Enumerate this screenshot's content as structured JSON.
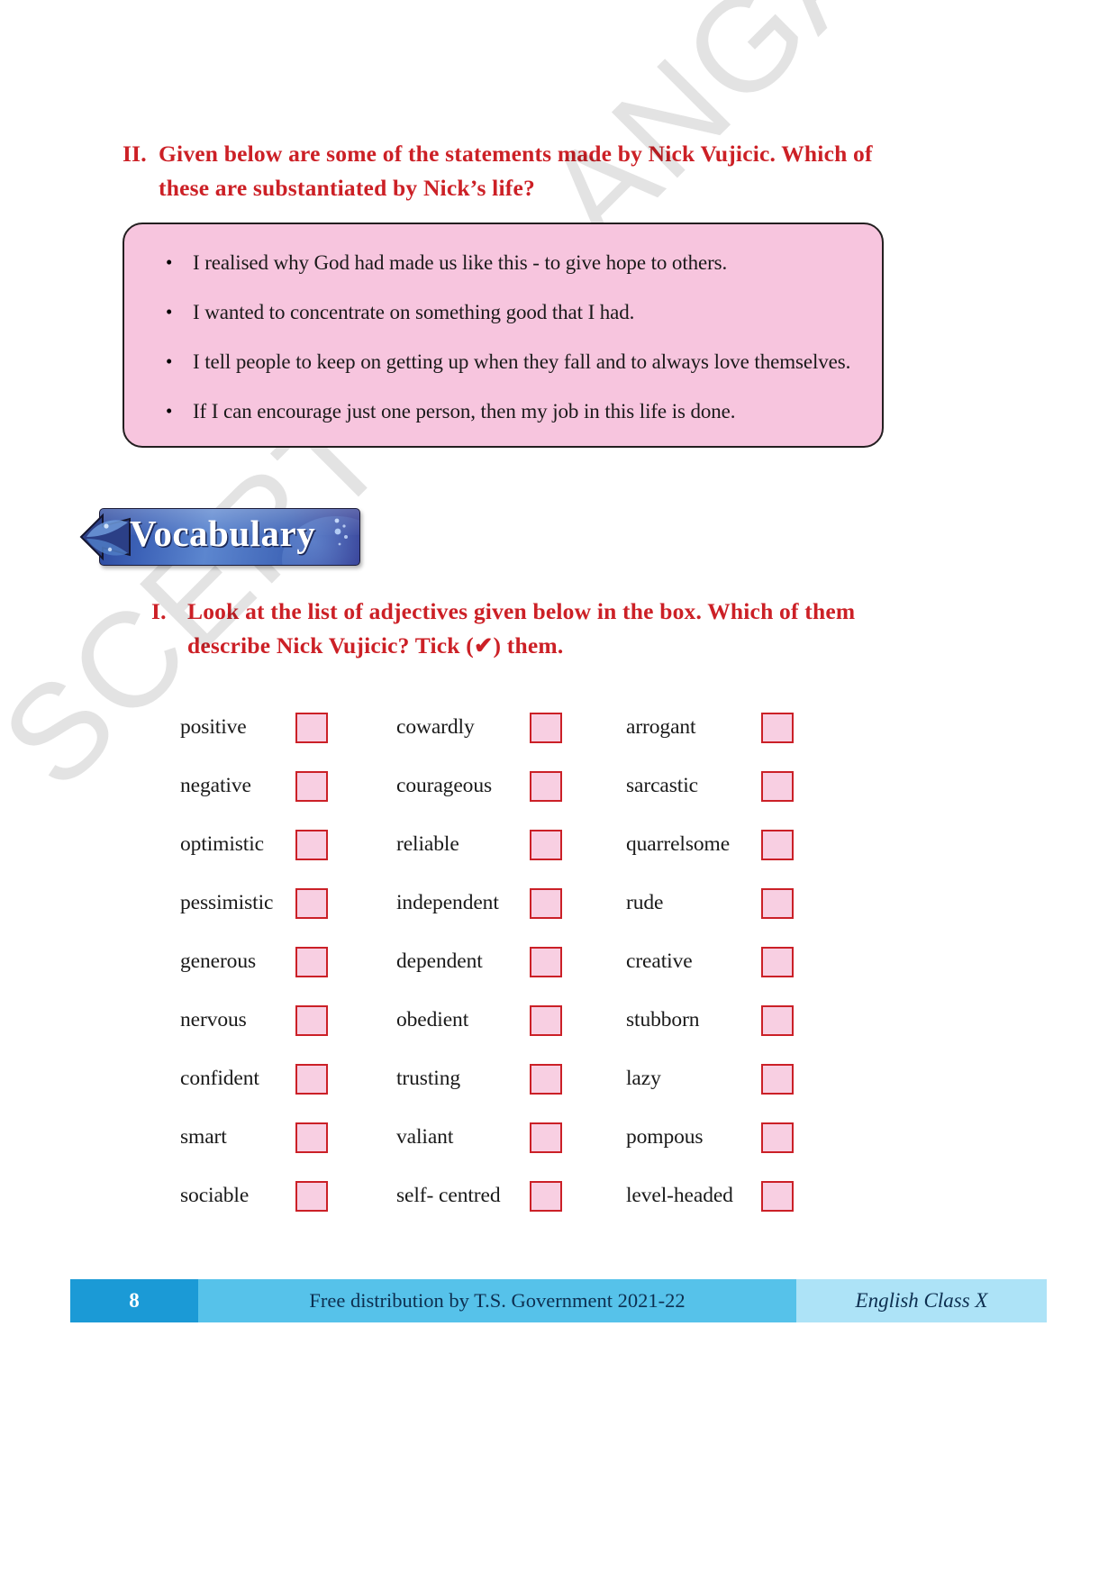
{
  "heading_2": {
    "marker": "II.",
    "text": "Given below are some of the statements made by Nick Vujicic. Which of these are substantiated by Nick’s life?"
  },
  "statement_box": {
    "bullets": [
      "I realised why God had made us like this - to give hope to others.",
      "I wanted to concentrate on something good that I had.",
      "I tell people to keep on getting up when they fall and to always love themselves.",
      "If I can encourage just one person, then my job in this life is done."
    ]
  },
  "vocabulary_banner": {
    "label": "Vocabulary"
  },
  "heading_1": {
    "marker": "I.",
    "text": "Look at the list of adjectives given below in the box. Which of them describe Nick Vujicic? Tick (✔) them."
  },
  "adjectives": {
    "rows": [
      {
        "col1": "positive",
        "col2": "cowardly",
        "col3": "arrogant"
      },
      {
        "col1": "negative",
        "col2": "courageous",
        "col3": "sarcastic"
      },
      {
        "col1": "optimistic",
        "col2": "reliable",
        "col3": "quarrelsome"
      },
      {
        "col1": "pessimistic",
        "col2": "independent",
        "col3": "rude"
      },
      {
        "col1": "generous",
        "col2": "dependent",
        "col3": "creative"
      },
      {
        "col1": "nervous",
        "col2": "obedient",
        "col3": "stubborn"
      },
      {
        "col1": "confident",
        "col2": "trusting",
        "col3": "lazy"
      },
      {
        "col1": "smart",
        "col2": "valiant",
        "col3": "pompous"
      },
      {
        "col1": "sociable",
        "col2": "self- centred",
        "col3": "level-headed"
      }
    ]
  },
  "watermark": {
    "text": "SCERT TELANGANA"
  },
  "footer": {
    "page_number": "8",
    "distribution": "Free distribution by T.S. Government 2021-22",
    "book": "English Class X"
  },
  "colors": {
    "heading_red": "#cc2026",
    "box_pink": "#f7c5de",
    "tick_border": "#cb2027",
    "tick_fill": "#f8cfe2",
    "footer_page_bg": "#1b9ad6",
    "footer_mid_bg": "#56c2ea",
    "footer_right_bg": "#ade3f7",
    "banner_blue": "#3d63b8"
  }
}
